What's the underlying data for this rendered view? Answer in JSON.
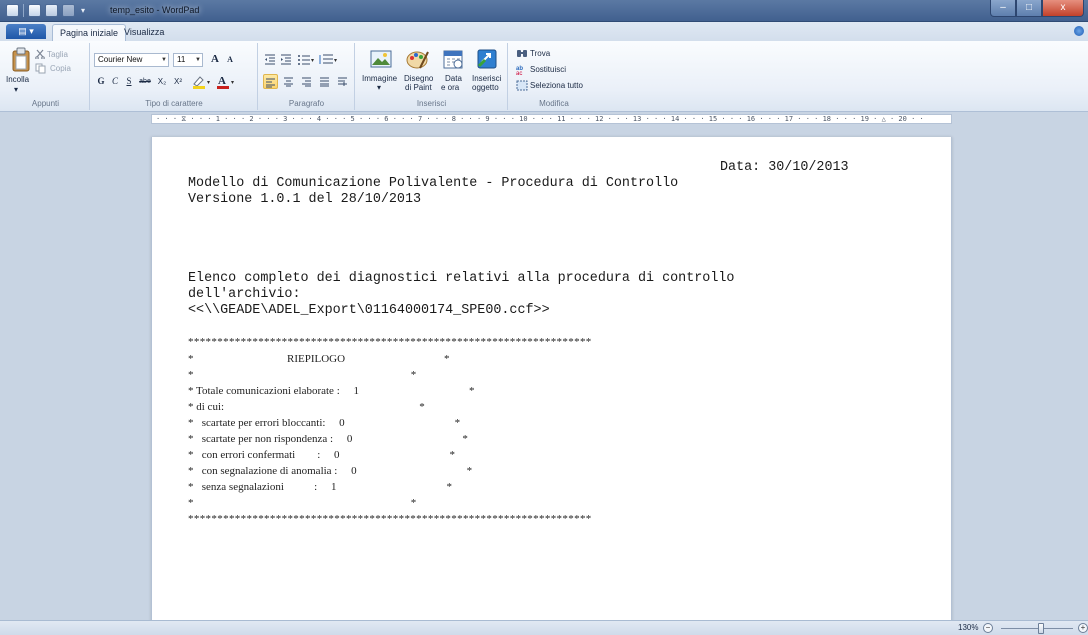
{
  "window": {
    "title": "temp_esito - WordPad",
    "controls": {
      "minimize": "–",
      "maximize": "□",
      "close": "x"
    }
  },
  "tabs": {
    "app_menu": "▤ ▾",
    "home": "Pagina iniziale",
    "view": "Visualizza"
  },
  "ribbon": {
    "clipboard": {
      "paste": "Incolla",
      "cut": "Taglia",
      "copy": "Copia",
      "label": "Appunti"
    },
    "font": {
      "family": "Courier New",
      "size": "11",
      "grow": "A",
      "shrink": "A",
      "bold": "G",
      "italic": "C",
      "underline": "S",
      "strike": "abe",
      "subscript": "X₂",
      "superscript": "X²",
      "label": "Tipo di carattere",
      "colors": {
        "highlight": "#f3d21c",
        "font_color": "#c9201c"
      }
    },
    "paragraph": {
      "label": "Paragrafo"
    },
    "insert": {
      "picture": "Immagine",
      "paint1": "Disegno",
      "paint2": "di Paint",
      "date1": "Data",
      "date2": "e ora",
      "object1": "Inserisci",
      "object2": "oggetto",
      "label": "Inserisci"
    },
    "editing": {
      "find": "Trova",
      "replace": "Sostituisci",
      "select_all": "Seleziona tutto",
      "label": "Modifica"
    }
  },
  "ruler": {
    "marks": "· · · ⧖ · · · 1 · · · 2 · · · 3 · · · 4 · · · 5 · · · 6 · · · 7 · · · 8 · · · 9 · · · 10 · · · 11 · · · 12 · · · 13 · · · 14 · · · 15 · · · 16 · · · 17 · · · 18 · · · 19 · △ · 20 · ·"
  },
  "document": {
    "date": "Data: 30/10/2013",
    "header1": "Modello di Comunicazione Polivalente - Procedura di Controllo",
    "header2": "Versione 1.0.1 del 28/10/2013",
    "intro1": "Elenco completo dei diagnostici relativi alla procedura di controllo",
    "intro2": "dell'archivio:",
    "intro3": "<<\\\\GEADE\\ADEL_Export\\01164000174_SPE00.ccf>>",
    "stars": "*********************************************************************",
    "box_lines": [
      "*                                  RIEPILOGO                                    *",
      "*                                                                               *",
      "* Totale comunicazioni elaborate :     1                                        *",
      "* di cui:                                                                       *",
      "*   scartate per errori bloccanti:     0                                        *",
      "*   scartate per non rispondenza :     0                                        *",
      "*   con errori confermati        :     0                                        *",
      "*   con segnalazione di anomalia :     0                                        *",
      "*   senza segnalazioni           :     1                                        *",
      "*                                                                               *"
    ]
  },
  "status": {
    "zoom": "130%",
    "zoom_out": "−",
    "zoom_in": "+"
  }
}
